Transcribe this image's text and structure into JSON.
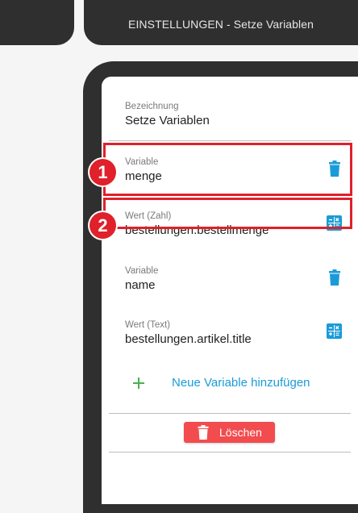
{
  "header": {
    "title": "EINSTELLUNGEN - Setze Variablen"
  },
  "form": {
    "name_field": {
      "label": "Bezeichnung",
      "value": "Setze Variablen"
    },
    "rows": [
      {
        "label": "Variable",
        "value": "menge",
        "icon": "trash-icon"
      },
      {
        "label": "Wert (Zahl)",
        "value": "bestellungen.bestellmenge",
        "icon": "calculator-icon"
      },
      {
        "label": "Variable",
        "value": "name",
        "icon": "trash-icon"
      },
      {
        "label": "Wert (Text)",
        "value": "bestellungen.artikel.title",
        "icon": "calculator-icon"
      }
    ],
    "add_label": "Neue Variable hinzufügen",
    "delete_label": "Löschen"
  },
  "annotations": {
    "marker_1": "1",
    "marker_2": "2"
  },
  "colors": {
    "topbar": "#2f2f2f",
    "accent": "#1a9bd8",
    "add_icon": "#4caf50",
    "delete_button": "#f24c4f",
    "highlight": "#e0202a"
  }
}
